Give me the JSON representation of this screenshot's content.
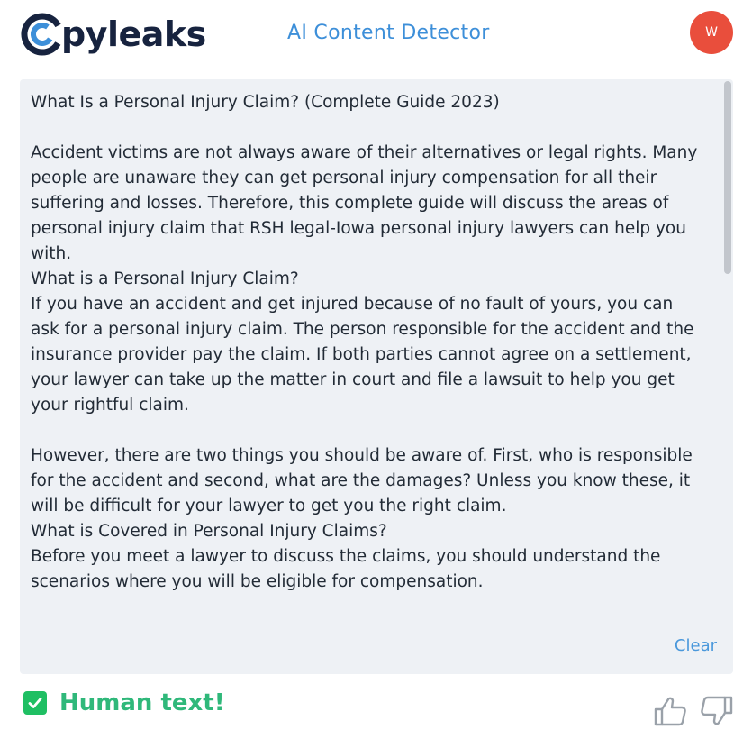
{
  "header": {
    "logo_text": "Copyleaks",
    "logo_suffix": "pyleaks",
    "app_title": "AI Content Detector",
    "avatar_initial": "W"
  },
  "editor": {
    "text": "What Is a Personal Injury Claim? (Complete Guide 2023)\n\nAccident victims are not always aware of their alternatives or legal rights. Many people are unaware they can get personal injury compensation for all their suffering and losses. Therefore, this complete guide will discuss the areas of personal injury claim that RSH legal-Iowa personal injury lawyers can help you with.\nWhat is a Personal Injury Claim?\nIf you have an accident and get injured because of no fault of yours, you can ask for a personal injury claim. The person responsible for the accident and the insurance provider pay the claim. If both parties cannot agree on a settlement, your lawyer can take up the matter in court and file a lawsuit to help you get your rightful claim.\n\nHowever, there are two things you should be aware of. First, who is responsible for the accident and second, what are the damages? Unless you know these, it will be difficult for your lawyer to get you the right claim.\nWhat is Covered in Personal Injury Claims?\nBefore you meet a lawyer to discuss the claims, you should understand the scenarios where you will be eligible for compensation.",
    "clear_label": "Clear"
  },
  "result": {
    "label": "Human text!",
    "icon": "check-icon"
  },
  "feedback": {
    "like_icon": "thumbs-up-icon",
    "dislike_icon": "thumbs-down-icon"
  },
  "colors": {
    "brand_blue": "#3d8fd9",
    "logo_navy": "#17233f",
    "avatar_red": "#e94e3c",
    "editor_bg": "#eef1f5",
    "human_green": "#2fb87a",
    "check_green": "#1fbf63"
  }
}
